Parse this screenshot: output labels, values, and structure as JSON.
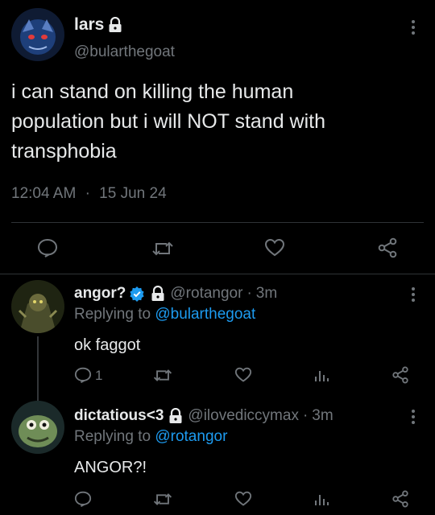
{
  "main_tweet": {
    "display_name": "lars",
    "handle": "@bularthegoat",
    "text_line1": "i can stand on killing the human",
    "text_line2": "population but i will NOT stand with",
    "text_line3": "transphobia",
    "time": "12:04 AM",
    "separator": "·",
    "date": "15 Jun 24"
  },
  "replies": [
    {
      "display_name": "angor?",
      "handle": "@rotangor",
      "separator": "·",
      "age": "3m",
      "replying_prefix": "Replying to",
      "replying_to": "@bularthegoat",
      "text": "ok faggot",
      "reply_count": "1"
    },
    {
      "display_name": "dictatious<3",
      "handle": "@ilovediccymax",
      "separator": "·",
      "age": "3m",
      "replying_prefix": "Replying to",
      "replying_to": "@rotangor",
      "text": "ANGOR?!"
    }
  ],
  "colors": {
    "background": "#000000",
    "text": "#e7e9ea",
    "muted": "#71767b",
    "accent": "#1d9bf0",
    "divider": "#2f3336"
  }
}
